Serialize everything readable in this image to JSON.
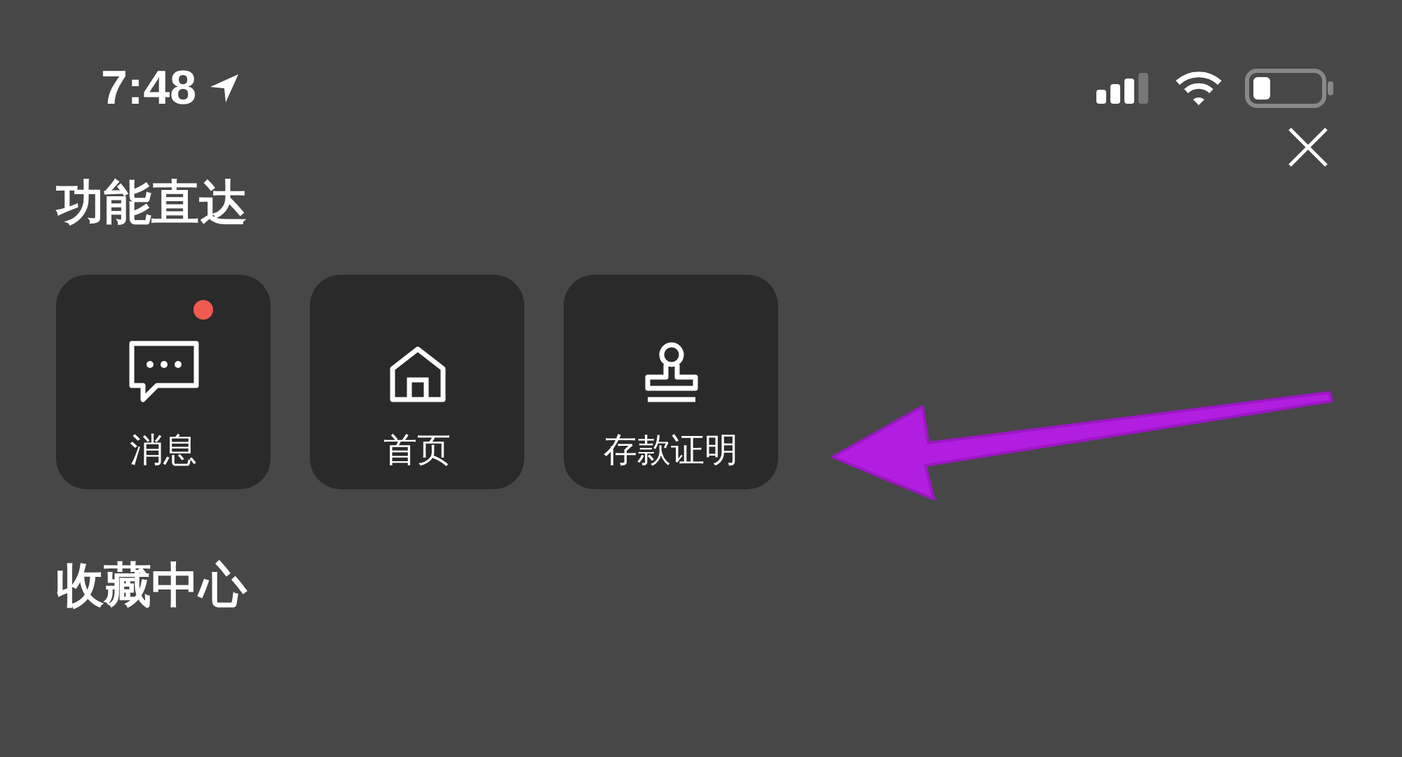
{
  "status_bar": {
    "time": "7:48"
  },
  "sections": [
    {
      "title": "功能直达"
    },
    {
      "title": "收藏中心"
    }
  ],
  "shortcuts": [
    {
      "kind": "message",
      "label": "消息",
      "badge": true
    },
    {
      "kind": "home",
      "label": "首页",
      "badge": false
    },
    {
      "kind": "stamp",
      "label": "存款证明",
      "badge": false
    }
  ]
}
